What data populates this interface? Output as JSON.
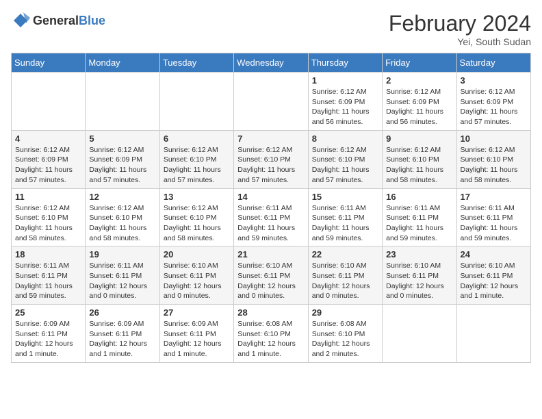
{
  "header": {
    "logo_line1": "General",
    "logo_line2": "Blue",
    "month_year": "February 2024",
    "location": "Yei, South Sudan"
  },
  "weekdays": [
    "Sunday",
    "Monday",
    "Tuesday",
    "Wednesday",
    "Thursday",
    "Friday",
    "Saturday"
  ],
  "weeks": [
    {
      "shaded": false,
      "days": [
        {
          "num": "",
          "info": ""
        },
        {
          "num": "",
          "info": ""
        },
        {
          "num": "",
          "info": ""
        },
        {
          "num": "",
          "info": ""
        },
        {
          "num": "1",
          "info": "Sunrise: 6:12 AM\nSunset: 6:09 PM\nDaylight: 11 hours\nand 56 minutes."
        },
        {
          "num": "2",
          "info": "Sunrise: 6:12 AM\nSunset: 6:09 PM\nDaylight: 11 hours\nand 56 minutes."
        },
        {
          "num": "3",
          "info": "Sunrise: 6:12 AM\nSunset: 6:09 PM\nDaylight: 11 hours\nand 57 minutes."
        }
      ]
    },
    {
      "shaded": true,
      "days": [
        {
          "num": "4",
          "info": "Sunrise: 6:12 AM\nSunset: 6:09 PM\nDaylight: 11 hours\nand 57 minutes."
        },
        {
          "num": "5",
          "info": "Sunrise: 6:12 AM\nSunset: 6:09 PM\nDaylight: 11 hours\nand 57 minutes."
        },
        {
          "num": "6",
          "info": "Sunrise: 6:12 AM\nSunset: 6:10 PM\nDaylight: 11 hours\nand 57 minutes."
        },
        {
          "num": "7",
          "info": "Sunrise: 6:12 AM\nSunset: 6:10 PM\nDaylight: 11 hours\nand 57 minutes."
        },
        {
          "num": "8",
          "info": "Sunrise: 6:12 AM\nSunset: 6:10 PM\nDaylight: 11 hours\nand 57 minutes."
        },
        {
          "num": "9",
          "info": "Sunrise: 6:12 AM\nSunset: 6:10 PM\nDaylight: 11 hours\nand 58 minutes."
        },
        {
          "num": "10",
          "info": "Sunrise: 6:12 AM\nSunset: 6:10 PM\nDaylight: 11 hours\nand 58 minutes."
        }
      ]
    },
    {
      "shaded": false,
      "days": [
        {
          "num": "11",
          "info": "Sunrise: 6:12 AM\nSunset: 6:10 PM\nDaylight: 11 hours\nand 58 minutes."
        },
        {
          "num": "12",
          "info": "Sunrise: 6:12 AM\nSunset: 6:10 PM\nDaylight: 11 hours\nand 58 minutes."
        },
        {
          "num": "13",
          "info": "Sunrise: 6:12 AM\nSunset: 6:10 PM\nDaylight: 11 hours\nand 58 minutes."
        },
        {
          "num": "14",
          "info": "Sunrise: 6:11 AM\nSunset: 6:11 PM\nDaylight: 11 hours\nand 59 minutes."
        },
        {
          "num": "15",
          "info": "Sunrise: 6:11 AM\nSunset: 6:11 PM\nDaylight: 11 hours\nand 59 minutes."
        },
        {
          "num": "16",
          "info": "Sunrise: 6:11 AM\nSunset: 6:11 PM\nDaylight: 11 hours\nand 59 minutes."
        },
        {
          "num": "17",
          "info": "Sunrise: 6:11 AM\nSunset: 6:11 PM\nDaylight: 11 hours\nand 59 minutes."
        }
      ]
    },
    {
      "shaded": true,
      "days": [
        {
          "num": "18",
          "info": "Sunrise: 6:11 AM\nSunset: 6:11 PM\nDaylight: 11 hours\nand 59 minutes."
        },
        {
          "num": "19",
          "info": "Sunrise: 6:11 AM\nSunset: 6:11 PM\nDaylight: 12 hours\nand 0 minutes."
        },
        {
          "num": "20",
          "info": "Sunrise: 6:10 AM\nSunset: 6:11 PM\nDaylight: 12 hours\nand 0 minutes."
        },
        {
          "num": "21",
          "info": "Sunrise: 6:10 AM\nSunset: 6:11 PM\nDaylight: 12 hours\nand 0 minutes."
        },
        {
          "num": "22",
          "info": "Sunrise: 6:10 AM\nSunset: 6:11 PM\nDaylight: 12 hours\nand 0 minutes."
        },
        {
          "num": "23",
          "info": "Sunrise: 6:10 AM\nSunset: 6:11 PM\nDaylight: 12 hours\nand 0 minutes."
        },
        {
          "num": "24",
          "info": "Sunrise: 6:10 AM\nSunset: 6:11 PM\nDaylight: 12 hours\nand 1 minute."
        }
      ]
    },
    {
      "shaded": false,
      "days": [
        {
          "num": "25",
          "info": "Sunrise: 6:09 AM\nSunset: 6:11 PM\nDaylight: 12 hours\nand 1 minute."
        },
        {
          "num": "26",
          "info": "Sunrise: 6:09 AM\nSunset: 6:11 PM\nDaylight: 12 hours\nand 1 minute."
        },
        {
          "num": "27",
          "info": "Sunrise: 6:09 AM\nSunset: 6:11 PM\nDaylight: 12 hours\nand 1 minute."
        },
        {
          "num": "28",
          "info": "Sunrise: 6:08 AM\nSunset: 6:10 PM\nDaylight: 12 hours\nand 1 minute."
        },
        {
          "num": "29",
          "info": "Sunrise: 6:08 AM\nSunset: 6:10 PM\nDaylight: 12 hours\nand 2 minutes."
        },
        {
          "num": "",
          "info": ""
        },
        {
          "num": "",
          "info": ""
        }
      ]
    }
  ]
}
